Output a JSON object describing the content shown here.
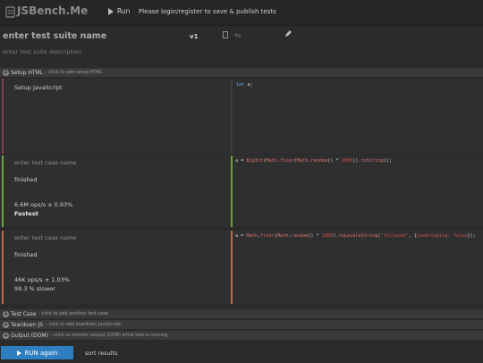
{
  "header": {
    "logo": "JSBench.Me",
    "run_label": "Run",
    "notice": "Please login/register to save & publish tests"
  },
  "suite": {
    "name_placeholder": "enter test suite name",
    "version": "v1",
    "by_label": "- by",
    "description_placeholder": "enter test suite description"
  },
  "setup_html": {
    "label": "Setup HTML",
    "hint": "- click to add setup HTML"
  },
  "setup_js": {
    "label": "Setup JavaScript",
    "code": {
      "kw": "let",
      "rest": " a;"
    }
  },
  "cases": [
    {
      "name_placeholder": "enter test case name",
      "status": "finished",
      "ops": "6.6M ops/s ± 0.93%",
      "rank": "Fastest",
      "stripe_color": "#6aa13a",
      "code": "a = BigInt(Math.floor(Math.random() * 1000)).toString();"
    },
    {
      "name_placeholder": "enter test case name",
      "status": "finished",
      "ops": "46K ops/s ± 1.03%",
      "rank": "99.3 % slower",
      "stripe_color": "#c06b3e",
      "code": "a = Math.floor(Math.random() * 1000).toLocaleString(\"fullwide\", {useGrouping: false});"
    }
  ],
  "footer_sections": [
    {
      "label": "Test Case",
      "hint": "- click to add another test case"
    },
    {
      "label": "Teardown JS",
      "hint": "- click to add teardown JavaScript"
    },
    {
      "label": "Output (DOM)",
      "hint": "- click to monitor output (DOM) while test is running"
    }
  ],
  "actions": {
    "run_again": "RUN again",
    "sort": "sort results"
  },
  "colors": {
    "accent": "#2f7fc0",
    "setup_stripe": "#8a3a4a",
    "fast_stripe": "#6aa13a",
    "slow_stripe": "#c06b3e"
  }
}
